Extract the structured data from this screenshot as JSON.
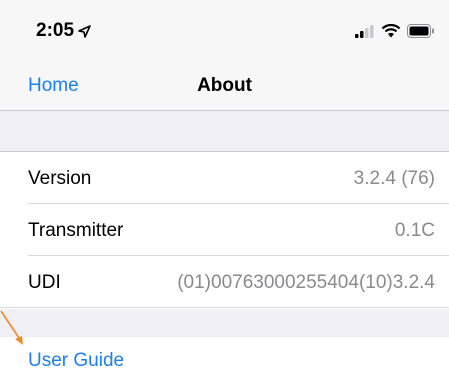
{
  "status_bar": {
    "time": "2:05",
    "icons": [
      "location-arrow-icon",
      "signal-icon",
      "wifi-icon",
      "battery-icon"
    ]
  },
  "nav": {
    "back_label": "Home",
    "title": "About"
  },
  "rows": [
    {
      "label": "Version",
      "value": "3.2.4 (76)"
    },
    {
      "label": "Transmitter",
      "value": "0.1C"
    },
    {
      "label": "UDI",
      "value": "(01)00763000255404(10)3.2.4"
    }
  ],
  "links": {
    "user_guide": "User Guide"
  },
  "colors": {
    "accent": "#1a7ff0",
    "annotation_arrow": "#f08a2a",
    "secondary_text": "#8a8a8e",
    "grouped_background": "#efeff4"
  }
}
